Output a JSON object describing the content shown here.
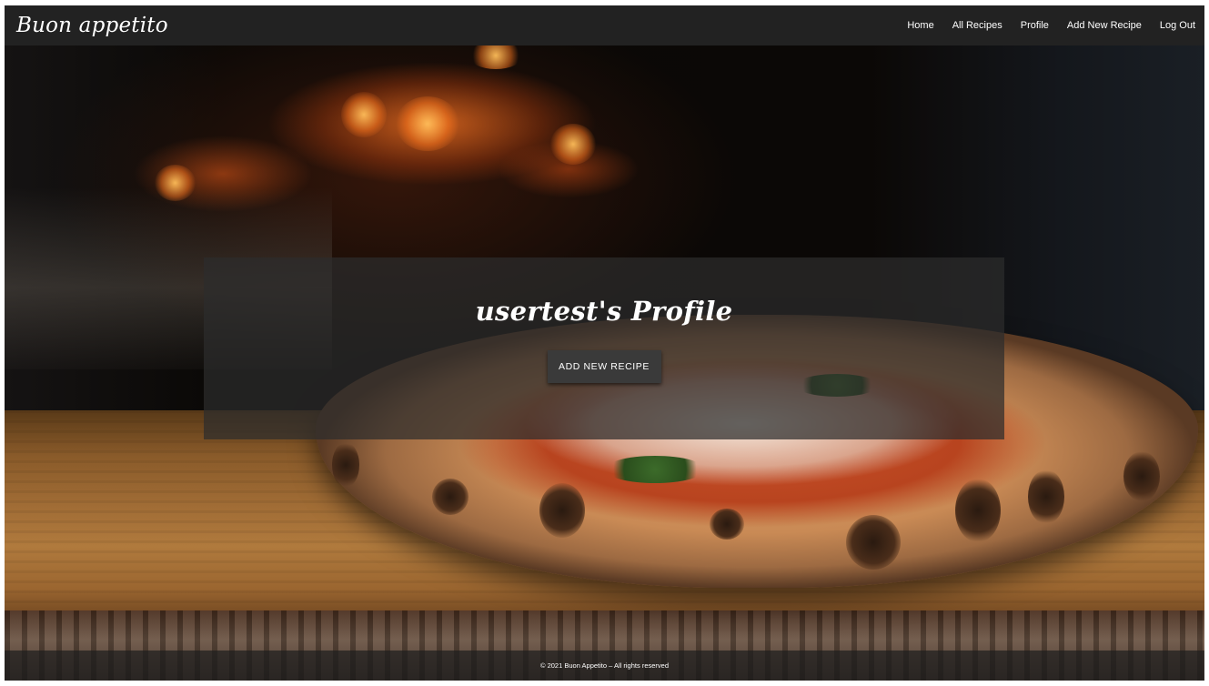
{
  "navbar": {
    "brand": "Buon appetito",
    "links": [
      {
        "label": "Home"
      },
      {
        "label": "All Recipes"
      },
      {
        "label": "Profile"
      },
      {
        "label": "Add New Recipe"
      },
      {
        "label": "Log Out"
      }
    ]
  },
  "profile": {
    "title": "usertest's Profile",
    "add_button_label": "Add New Recipe"
  },
  "footer": {
    "text": "© 2021 Buon Appetito – All rights reserved"
  },
  "colors": {
    "navbar_bg": "#222222",
    "panel_bg": "rgba(45,45,45,0.72)",
    "button_bg": "#3a3a3a",
    "text": "#ffffff"
  }
}
